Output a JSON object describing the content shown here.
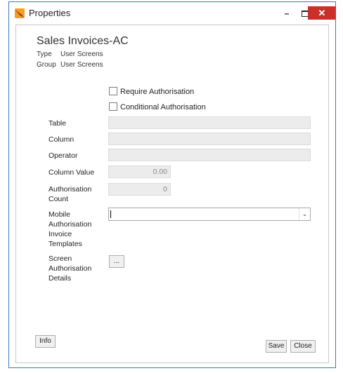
{
  "window": {
    "title": "Properties",
    "controls": {
      "minimize": "–",
      "close": "✕"
    }
  },
  "header": {
    "heading": "Sales Invoices-AC",
    "type_key": "Type",
    "type_value": "User Screens",
    "group_key": "Group",
    "group_value": "User Screens"
  },
  "checkboxes": {
    "require_authorisation": {
      "label": "Require Authorisation",
      "checked": false
    },
    "conditional_authorisation": {
      "label": "Conditional Authorisation",
      "checked": false
    }
  },
  "form": {
    "table_label": "Table",
    "table_value": "",
    "column_label": "Column",
    "column_value": "",
    "operator_label": "Operator",
    "operator_value": "",
    "column_value_label": "Column Value",
    "column_value_value": "0.00",
    "auth_count_label_1": "Authorisation",
    "auth_count_label_2": "Count",
    "auth_count_value": "0",
    "mobile_label_1": "Mobile",
    "mobile_label_2": "Authorisation",
    "mobile_label_3": "Invoice",
    "mobile_label_4": "Templates",
    "mobile_value": "",
    "screen_label_1": "Screen",
    "screen_label_2": "Authorisation",
    "screen_label_3": "Details",
    "ellipsis_label": "..."
  },
  "buttons": {
    "info": "Info",
    "save": "Save",
    "close": "Close"
  },
  "icons": {
    "app": "app-logo-icon",
    "dropdown": "chevron-down-icon"
  },
  "colors": {
    "close_button": "#c9302c",
    "app_icon": "#f4a11a",
    "window_border": "#3b7bbf"
  }
}
